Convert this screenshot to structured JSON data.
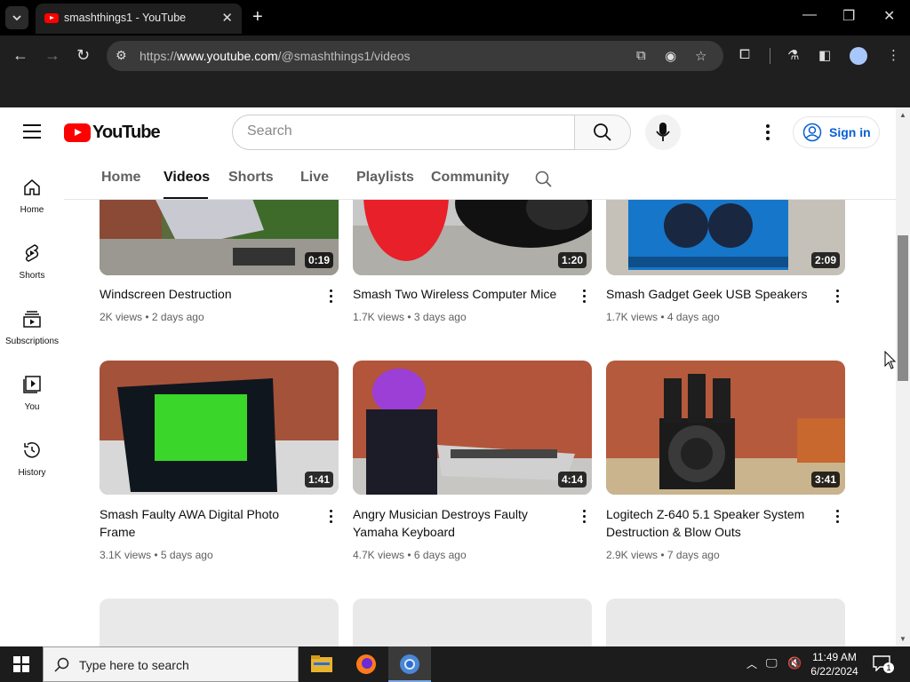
{
  "browser": {
    "tab_title": "smashthings1 - YouTube",
    "new_tab": "+",
    "url_prefix": "https://",
    "url_host": "www.youtube.com",
    "url_path": "/@smashthings1/videos"
  },
  "header": {
    "logo_text": "YouTube",
    "search_placeholder": "Search",
    "signin_label": "Sign in"
  },
  "sidebar": {
    "items": [
      {
        "label": "Home",
        "icon": "home-icon"
      },
      {
        "label": "Shorts",
        "icon": "shorts-icon"
      },
      {
        "label": "Subscriptions",
        "icon": "subscriptions-icon"
      },
      {
        "label": "You",
        "icon": "you-icon"
      },
      {
        "label": "History",
        "icon": "history-icon"
      }
    ]
  },
  "channel_tabs": [
    "Home",
    "Videos",
    "Shorts",
    "Live",
    "Playlists",
    "Community"
  ],
  "active_tab": "Videos",
  "videos": [
    {
      "title": "Windscreen Destruction",
      "title2": "",
      "duration": "0:19",
      "views": "2K views",
      "age": "2 days ago"
    },
    {
      "title": "Smash Two Wireless Computer Mice",
      "title2": "",
      "duration": "1:20",
      "views": "1.7K views",
      "age": "3 days ago"
    },
    {
      "title": "Smash Gadget Geek USB Speakers",
      "title2": "",
      "duration": "2:09",
      "views": "1.7K views",
      "age": "4 days ago"
    },
    {
      "title": "Smash Faulty AWA Digital Photo",
      "title2": "Frame",
      "duration": "1:41",
      "views": "3.1K views",
      "age": "5 days ago"
    },
    {
      "title": "Angry Musician Destroys Faulty",
      "title2": "Yamaha Keyboard",
      "duration": "4:14",
      "views": "4.7K views",
      "age": "6 days ago"
    },
    {
      "title": "Logitech Z-640 5.1 Speaker System",
      "title2": "Destruction & Blow Outs",
      "duration": "3:41",
      "views": "2.9K views",
      "age": "7 days ago"
    }
  ],
  "taskbar": {
    "search_label": "Type here to search",
    "time": "11:49 AM",
    "date": "6/22/2024",
    "notification_count": "1"
  },
  "colors": {
    "yt_red": "#ff0000",
    "link_blue": "#065fd4"
  }
}
